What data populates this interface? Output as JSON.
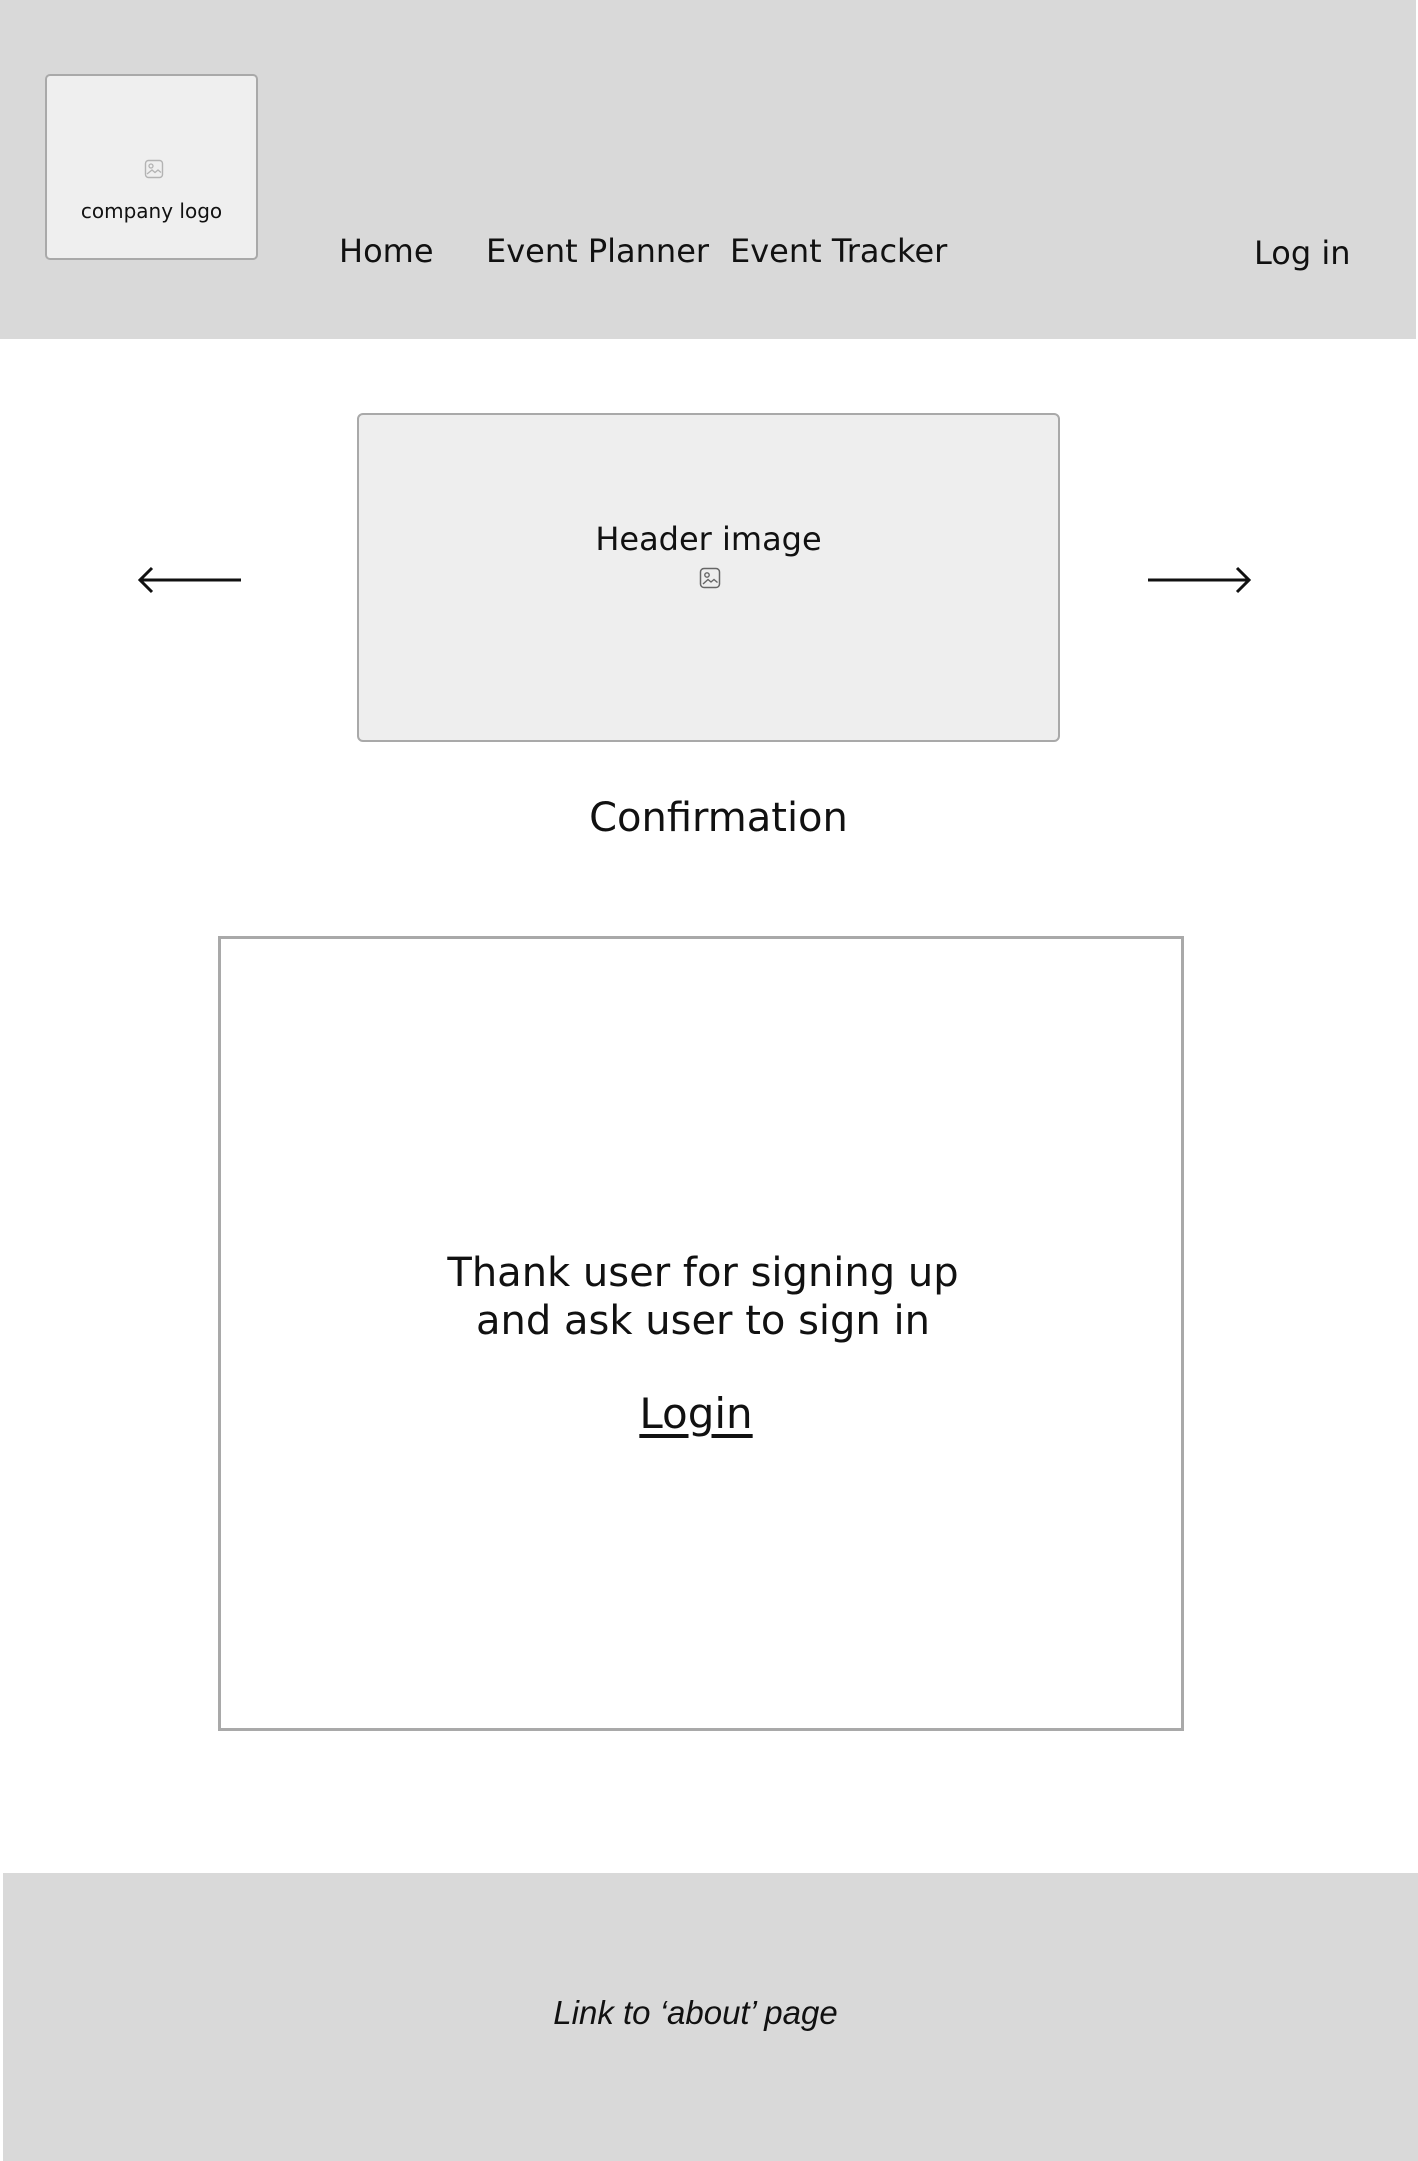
{
  "header": {
    "logo_text": "company logo",
    "logo_icon": "image-placeholder-icon",
    "nav": {
      "home": "Home",
      "event_planner": "Event Planner",
      "event_tracker": "Event Tracker"
    },
    "login": "Log in"
  },
  "carousel": {
    "prev_icon": "arrow-left-icon",
    "next_icon": "arrow-right-icon",
    "image_label": "Header image",
    "image_icon": "image-placeholder-icon"
  },
  "main": {
    "title": "Confirmation",
    "message_line1": "Thank user for signing up",
    "message_line2": "and ask user to sign in",
    "login_link": "Login"
  },
  "footer": {
    "link": "Link to ‘about’ page"
  },
  "colors": {
    "header_bg": "#d9d9d9",
    "footer_bg": "#d9d9d9",
    "placeholder_bg": "#eeeeee",
    "border": "#a9a9a9",
    "text": "#111111"
  }
}
